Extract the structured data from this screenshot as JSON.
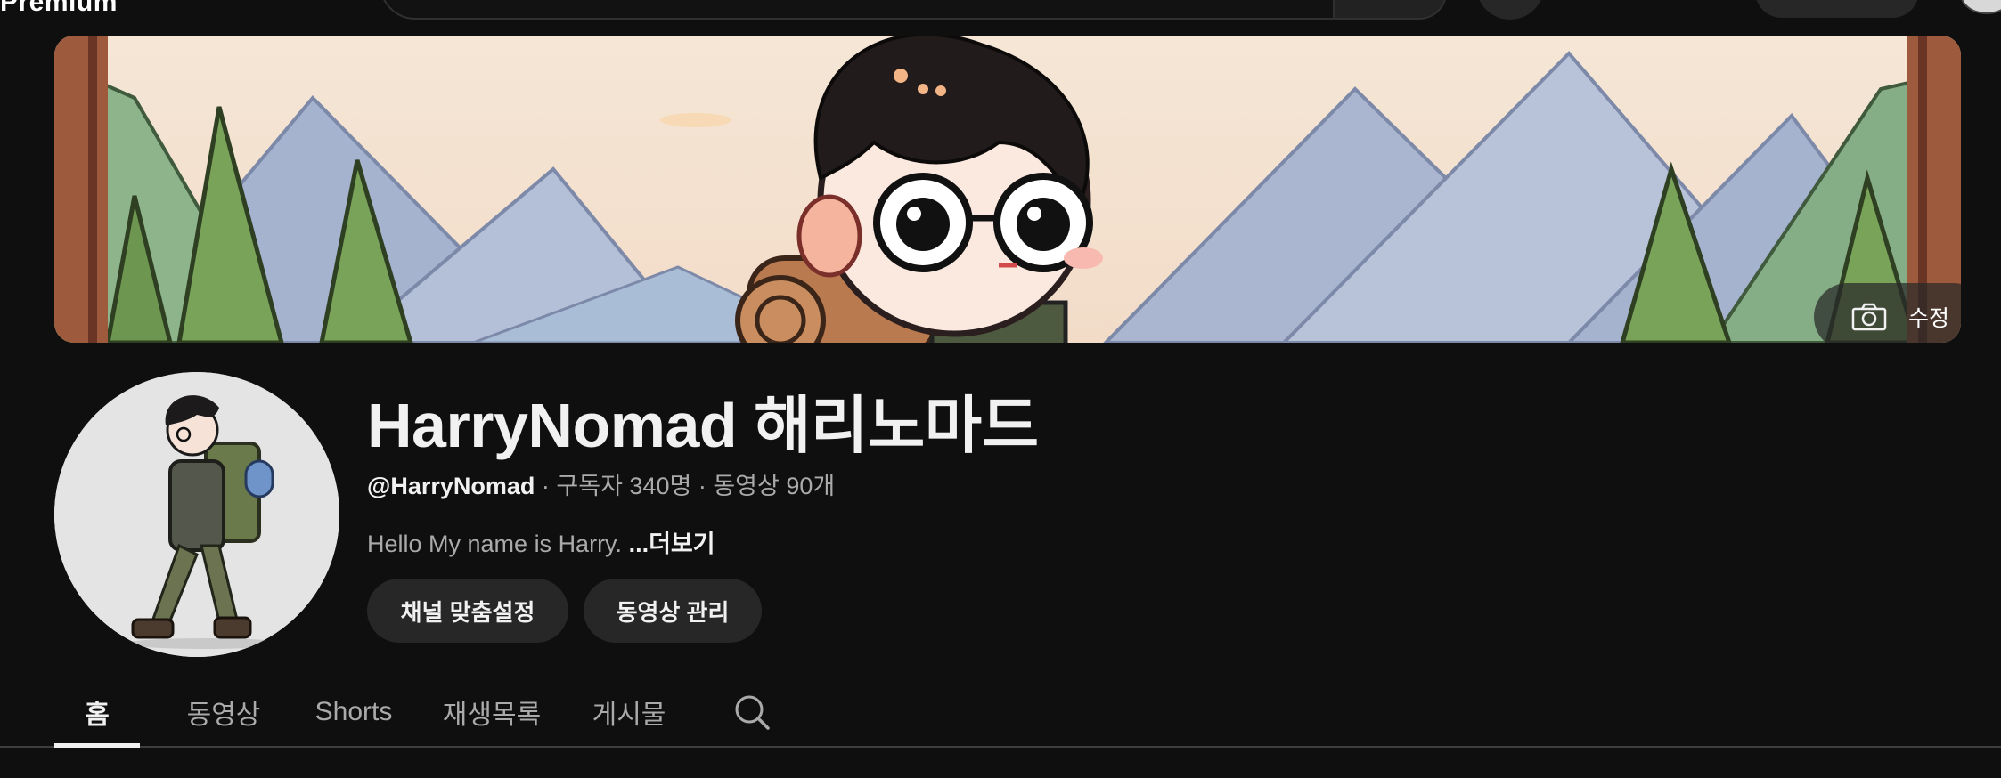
{
  "topbar": {
    "logo_text": "Premium"
  },
  "banner": {
    "edit_label": "수정"
  },
  "channel": {
    "title": "HarryNomad 해리노마드",
    "handle": "@HarryNomad",
    "subscribers": "구독자 340명",
    "videos": "동영상 90개",
    "separator": " · ",
    "description": "Hello My name is Harry. ",
    "more_label": "...더보기"
  },
  "actions": {
    "customize_label": "채널 맞춤설정",
    "manage_label": "동영상 관리"
  },
  "tabs": [
    {
      "label": "홈",
      "active": true
    },
    {
      "label": "동영상",
      "active": false
    },
    {
      "label": "Shorts",
      "active": false
    },
    {
      "label": "재생목록",
      "active": false
    },
    {
      "label": "게시물",
      "active": false
    }
  ],
  "colors": {
    "background": "#0f0f0f",
    "text_primary": "#f1f1f1",
    "text_secondary": "#aaaaaa",
    "button_bg": "#272727"
  }
}
